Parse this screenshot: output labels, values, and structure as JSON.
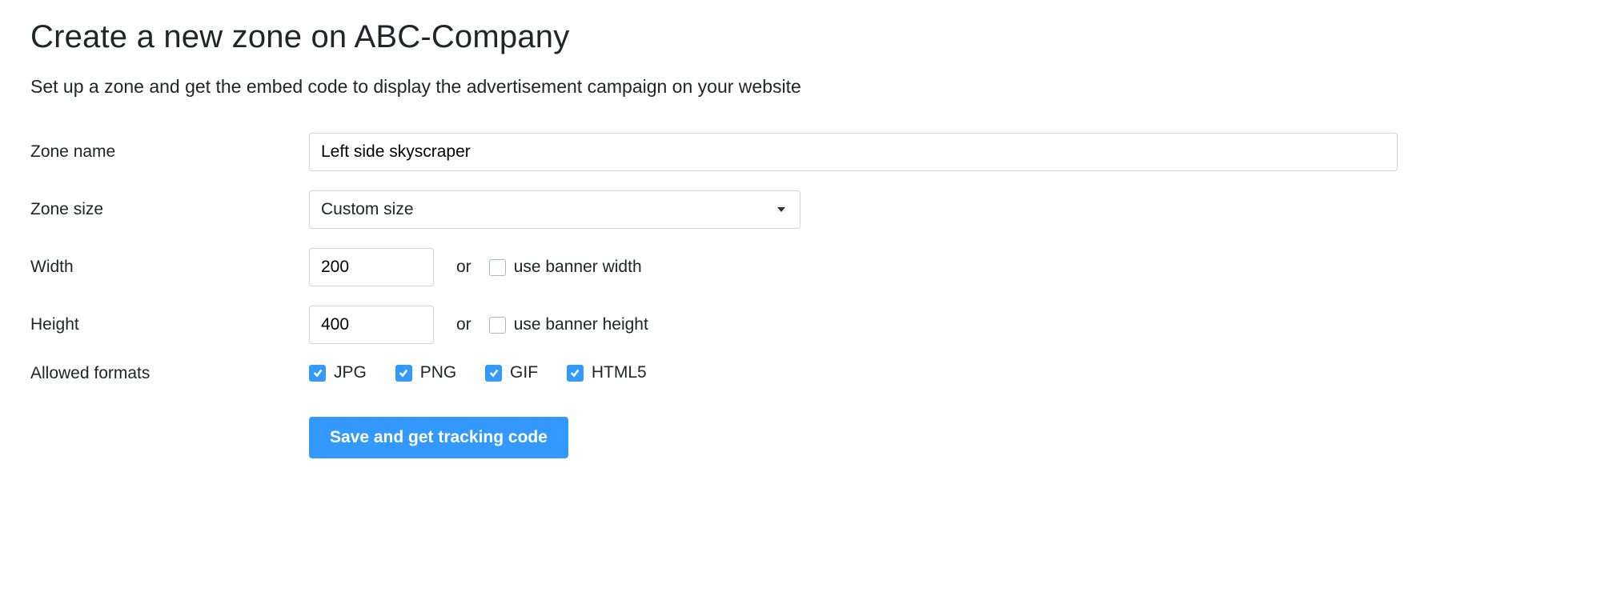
{
  "page": {
    "title": "Create a new zone on  ABC-Company",
    "subtitle": "Set up a zone and get the embed code to display the advertisement campaign on your website"
  },
  "form": {
    "zone_name": {
      "label": "Zone name",
      "value": "Left side skyscraper"
    },
    "zone_size": {
      "label": "Zone size",
      "selected": "Custom size"
    },
    "width": {
      "label": "Width",
      "value": "200",
      "or": "or",
      "use_banner_label": "use banner width",
      "use_banner_checked": false
    },
    "height": {
      "label": "Height",
      "value": "400",
      "or": "or",
      "use_banner_label": "use banner height",
      "use_banner_checked": false
    },
    "allowed_formats": {
      "label": "Allowed formats",
      "options": [
        {
          "label": "JPG",
          "checked": true
        },
        {
          "label": "PNG",
          "checked": true
        },
        {
          "label": "GIF",
          "checked": true
        },
        {
          "label": "HTML5",
          "checked": true
        }
      ]
    },
    "submit_label": "Save and get tracking code"
  }
}
